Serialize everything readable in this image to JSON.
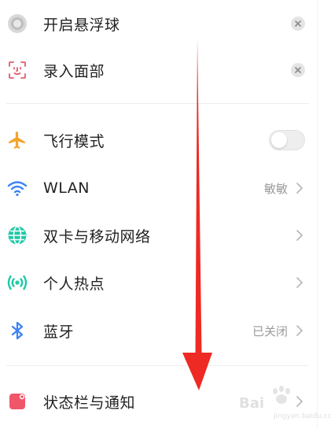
{
  "settings": {
    "floating_ball": {
      "label": "开启悬浮球",
      "icon": "floating-ball-icon"
    },
    "face_unlock": {
      "label": "录入面部",
      "icon": "face-scan-icon"
    },
    "airplane": {
      "label": "飞行模式",
      "icon": "airplane-icon",
      "enabled": false
    },
    "wlan": {
      "label": "WLAN",
      "value": "敏敏",
      "icon": "wifi-icon"
    },
    "sim_network": {
      "label": "双卡与移动网络",
      "icon": "globe-icon"
    },
    "hotspot": {
      "label": "个人热点",
      "icon": "hotspot-icon"
    },
    "bluetooth": {
      "label": "蓝牙",
      "value": "已关闭",
      "icon": "bluetooth-icon"
    },
    "status_bar": {
      "label": "状态栏与通知",
      "icon": "status-bar-icon"
    }
  },
  "overlay": {
    "arrow_color": "#ee2a24",
    "arrow_direction": "down"
  },
  "watermark": {
    "text": "Bai",
    "sub": "jingyan.baidu.com"
  },
  "colors": {
    "airplane": "#f5a42b",
    "wifi": "#3b82f6",
    "globe": "#1fc9a6",
    "hotspot": "#1fc9a6",
    "bluetooth": "#3b82f6",
    "status_bar": "#f0566a",
    "face": "#e05a72"
  }
}
